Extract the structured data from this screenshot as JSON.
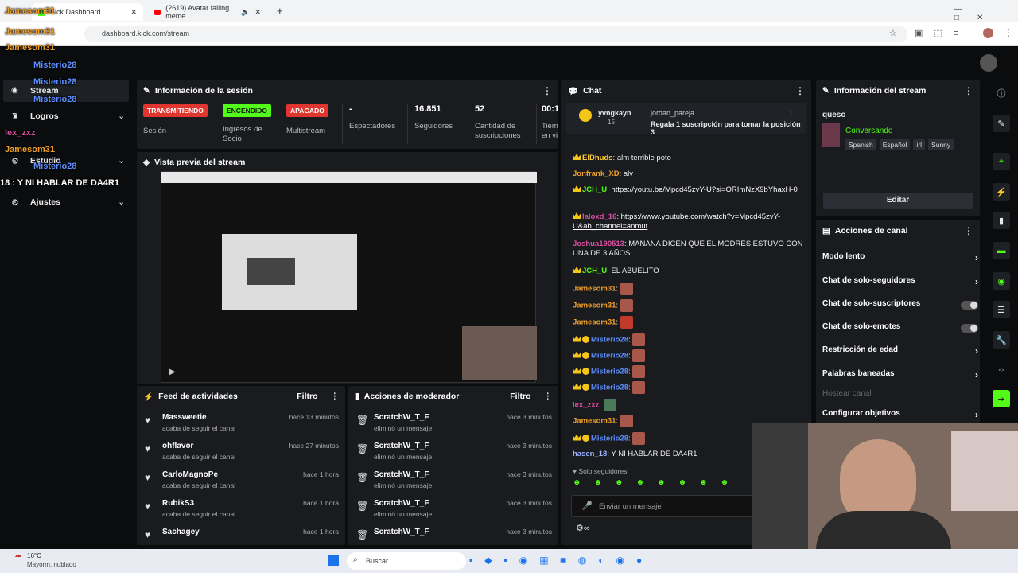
{
  "browser": {
    "tab1": "Kick Dashboard",
    "tab2": "(2619) Avatar falling meme",
    "url": "dashboard.kick.com/stream"
  },
  "nav": {
    "stream": "Stream",
    "logros": "Logros",
    "estudio": "Estudio",
    "ajustes": "Ajustes"
  },
  "session": {
    "title": "Información de la sesión",
    "transmitiendo": "TRANSMITIENDO",
    "sesion": "Sesión",
    "encendido": "ENCENDIDO",
    "ingresos": "Ingresos de Socio",
    "apagado": "APAGADO",
    "multistream": "Multistream",
    "espectadores_val": "-",
    "espectadores": "Espectadores",
    "seguidores_val": "16.851",
    "seguidores": "Seguidores",
    "subs_val": "52",
    "subs": "Cantidad de suscripciones",
    "tiempo_val": "00:1",
    "tiempo": "Tiem en vi"
  },
  "preview": {
    "title": "Vista previa del stream"
  },
  "feed": {
    "title": "Feed de actividades",
    "filtro": "Filtro",
    "rows": [
      {
        "name": "Massweetie",
        "sub": "acaba de seguir el canal",
        "time": "hace 13 minutos"
      },
      {
        "name": "ohflavor",
        "sub": "acaba de seguir el canal",
        "time": "hace 27 minutos"
      },
      {
        "name": "CarloMagnoPe",
        "sub": "acaba de seguir el canal",
        "time": "hace 1 hora"
      },
      {
        "name": "RubikS3",
        "sub": "acaba de seguir el canal",
        "time": "hace 1 hora"
      },
      {
        "name": "Sachagey",
        "sub": "",
        "time": "hace 1 hora"
      }
    ]
  },
  "mod": {
    "title": "Acciones de moderador",
    "filtro": "Filtro",
    "rows": [
      {
        "name": "ScratchW_T_F",
        "sub": "eliminó un mensaje",
        "time": "hace 3 minutos"
      },
      {
        "name": "ScratchW_T_F",
        "sub": "eliminó un mensaje",
        "time": "hace 3 minutos"
      },
      {
        "name": "ScratchW_T_F",
        "sub": "eliminó un mensaje",
        "time": "hace 3 minutos"
      },
      {
        "name": "ScratchW_T_F",
        "sub": "eliminó un mensaje",
        "time": "hace 3 minutos"
      },
      {
        "name": "ScratchW_T_F",
        "sub": "",
        "time": "hace 3 minutos"
      }
    ]
  },
  "chat": {
    "title": "Chat",
    "pin_user": "yvngkayn",
    "pin_level": "15",
    "pin_target": "jordan_pareja",
    "pin_count": "1",
    "pin_text": "Regala 1 suscripción para tomar la posición 3",
    "l1_user": "ElDhuds",
    "l1_text": "alm terrible poto",
    "l2_user": "Jonfrank_XD",
    "l2_text": "alv",
    "l3_user": "JCH_U",
    "l3_text": "https://youtu.be/Mpcd45zvY-U?si=ORImNzX9bYhaxH-0",
    "l4_user": "laloxd_16",
    "l4_text": "https://www.youtube.com/watch?v=Mpcd45zvY-U&ab_channel=anmut",
    "l5_user": "Joshua190513",
    "l5_text": "MAÑANA DICEN QUE EL MODRES ESTUVO CON UNA DE 3 AÑOS",
    "l6_user": "JCH_U",
    "l6_text": "EL ABUELITO",
    "l7_user": "Jamesom31",
    "l10_user": "Misterio28",
    "l14_user": "lex_zxz",
    "l17_user": "hasen_18",
    "l17_text": "Y NI HABLAR DE DA4R1",
    "solo": "Solo seguidores",
    "placeholder": "Enviar un mensaje"
  },
  "info": {
    "title": "Información del stream",
    "stream_title": "queso",
    "category": "Conversando",
    "tags": [
      "Spanish",
      "Español",
      "irl",
      "Sunny"
    ],
    "edit": "Editar"
  },
  "actions": {
    "title": "Acciones de canal",
    "items": [
      "Modo lento",
      "Chat de solo-seguidores",
      "Chat de solo-suscriptores",
      "Chat de solo-emotes",
      "Restricción de edad",
      "Palabras baneadas",
      "Hostear canal",
      "Configurar objetivos"
    ]
  },
  "overlay": {
    "o1": "Jamesom31",
    "o2": "Jamesom31",
    "o3": "Jamesom31",
    "o4": "Misterio28",
    "o5": "Misterio28",
    "o6": "Misterio28",
    "o7": "lex_zxz",
    "o8": "Jamesom31",
    "o9": "Misterio28",
    "o10": "18 : Y NI HABLAR DE DA4R1"
  },
  "taskbar": {
    "temp": "16°C",
    "weather": "Mayorm. nublado",
    "search": "Buscar"
  }
}
